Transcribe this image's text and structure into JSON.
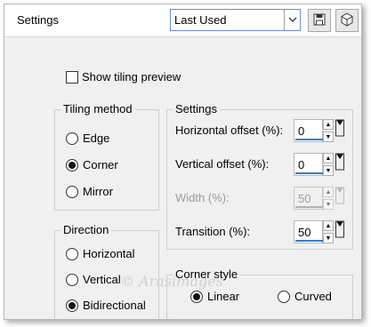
{
  "dialog": {
    "title": "Settings",
    "preset_value": "Last Used"
  },
  "show_tiling_preview": {
    "label": "Show tiling preview",
    "checked": false
  },
  "tiling_method": {
    "title": "Tiling method",
    "options": [
      "Edge",
      "Corner",
      "Mirror"
    ],
    "selected": "Corner"
  },
  "direction": {
    "title": "Direction",
    "options": [
      "Horizontal",
      "Vertical",
      "Bidirectional"
    ],
    "selected": "Bidirectional"
  },
  "settings": {
    "title": "Settings",
    "horizontal_offset": {
      "label": "Horizontal offset (%):",
      "value": "0"
    },
    "vertical_offset": {
      "label": "Vertical offset (%):",
      "value": "0"
    },
    "width": {
      "label": "Width (%):",
      "value": "50",
      "disabled": true
    },
    "transition": {
      "label": "Transition (%):",
      "value": "50"
    }
  },
  "corner_style": {
    "title": "Corner style",
    "options": [
      "Linear",
      "Curved"
    ],
    "selected": "Linear"
  },
  "watermark": "© Arasimages",
  "icons": {
    "save": "save-icon",
    "presets": "presets-icon",
    "dropdown": "chevron-down-icon"
  }
}
